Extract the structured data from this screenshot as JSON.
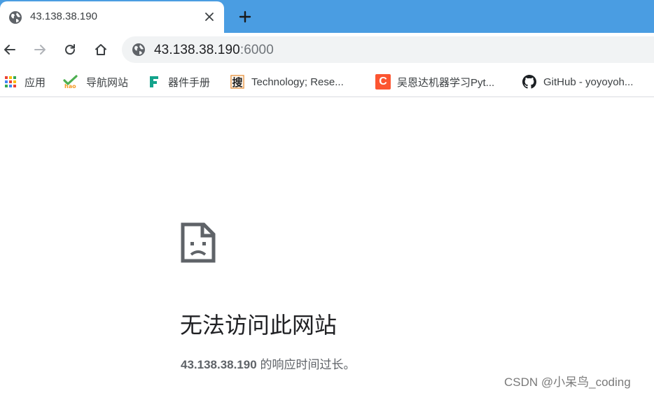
{
  "tab": {
    "title": "43.138.38.190",
    "favicon": "globe-icon",
    "close_icon": "close-icon",
    "new_tab_icon": "plus-icon"
  },
  "toolbar": {
    "back_icon": "back-arrow-icon",
    "forward_icon": "forward-arrow-icon",
    "reload_icon": "reload-icon",
    "home_icon": "home-icon",
    "omnibox": {
      "icon": "globe-icon",
      "host": "43.138.38.190",
      "port": ":6000"
    }
  },
  "bookmarks": [
    {
      "label": "应用",
      "icon": "apps-grid-icon"
    },
    {
      "label": "导航网站",
      "icon": "hao-icon"
    },
    {
      "label": "器件手册",
      "icon": "letter-f-icon"
    },
    {
      "label": "Technology; Rese...",
      "icon": "sou-icon",
      "icon_text": "搜"
    },
    {
      "label": "吴恩达机器学习Pyt...",
      "icon": "csdn-c-icon",
      "icon_text": "C"
    },
    {
      "label": "GitHub - yoyoyoh...",
      "icon": "github-icon"
    }
  ],
  "error": {
    "icon": "sad-page-icon",
    "title": "无法访问此网站",
    "host": "43.138.38.190",
    "message": " 的响应时间过长。"
  },
  "watermark": "CSDN @小呆鸟_coding",
  "colors": {
    "tabstrip": "#4a9de2",
    "omnibox_bg": "#f1f3f4",
    "text_primary": "#202124",
    "text_secondary": "#5f6368"
  }
}
